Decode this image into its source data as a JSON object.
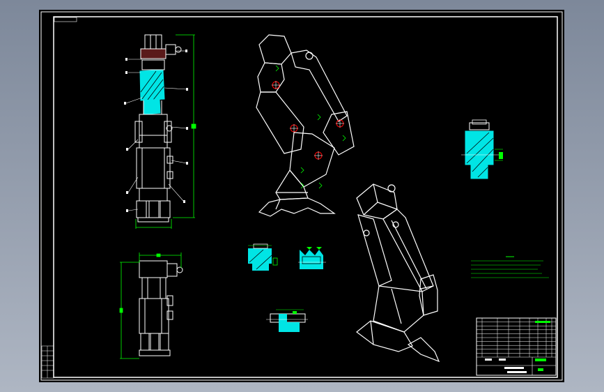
{
  "colors": {
    "background": "#000000",
    "outline": "#ffffff",
    "dimension": "#00ff00",
    "section_fill": "#00e5e5",
    "joint": "#ff0000",
    "frame_outer": "#9aa3b2"
  },
  "drawing": {
    "title_block": {
      "part_list_rows": 10,
      "part_list_cols": 8
    },
    "notes": {
      "line_count": 5
    }
  }
}
